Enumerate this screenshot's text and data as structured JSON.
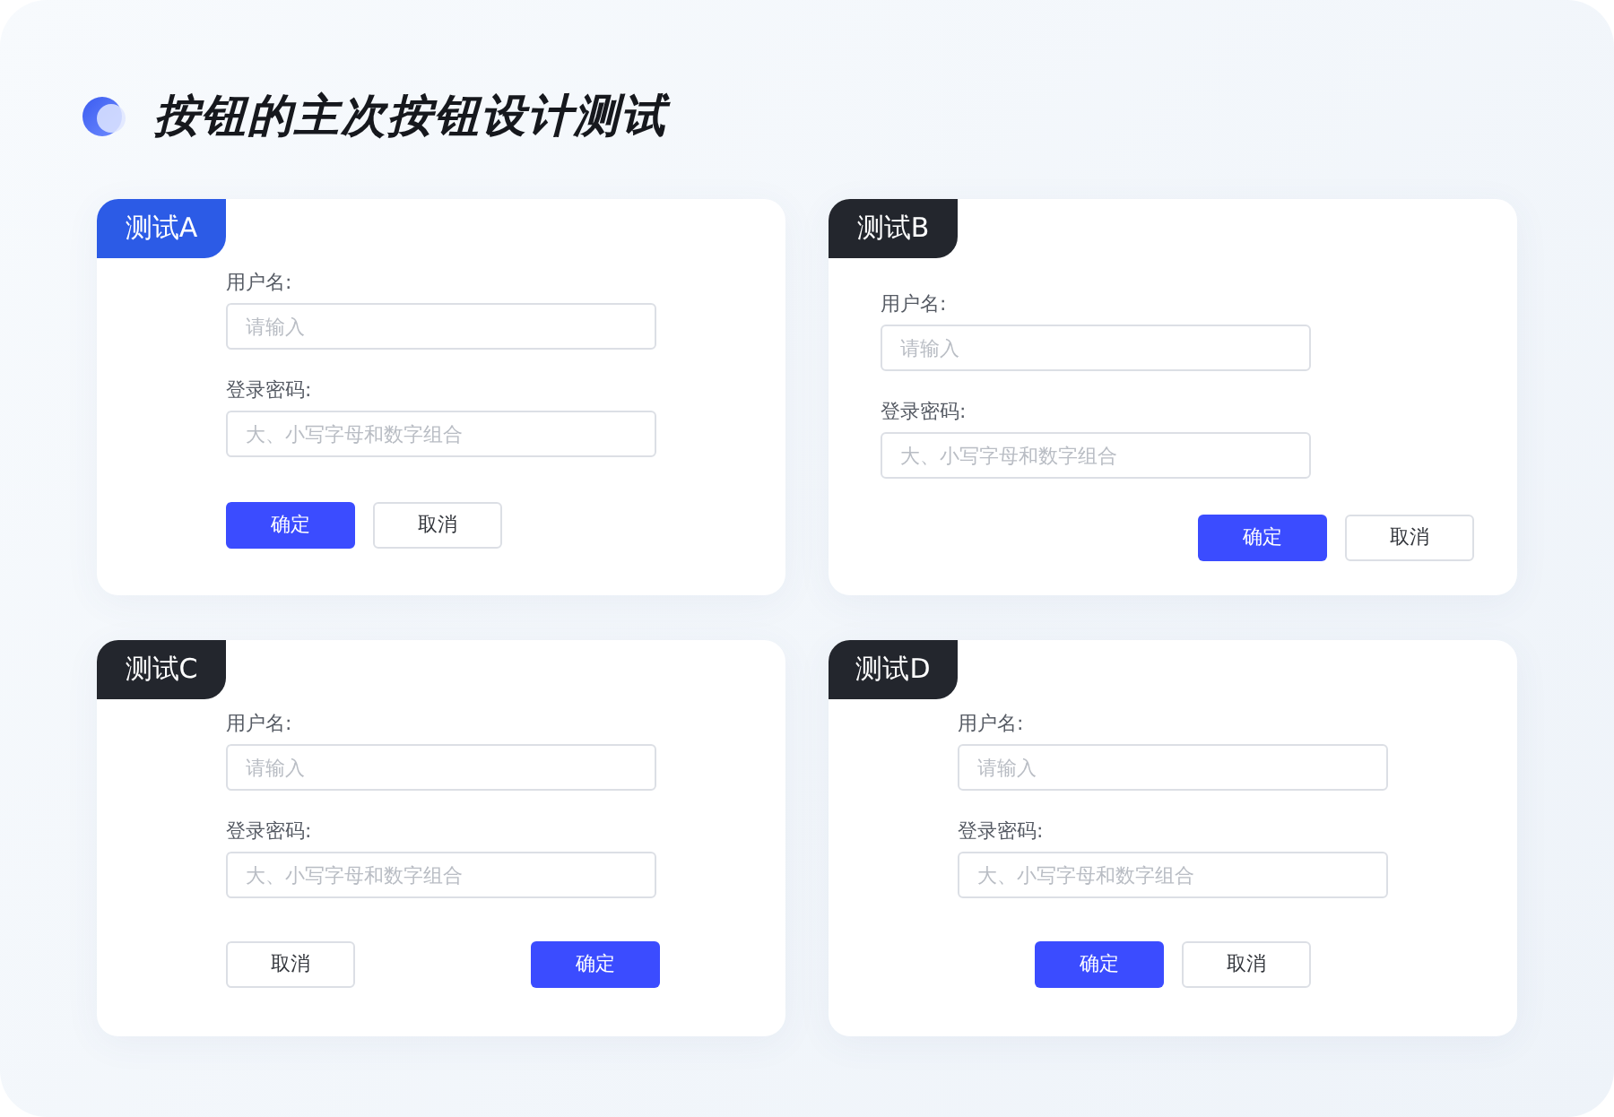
{
  "title": "按钮的主次按钮设计测试",
  "cards": [
    {
      "tab": {
        "label": "测试A",
        "color": "#2c5be6"
      },
      "kind": "start",
      "fields": [
        {
          "label": "用户名:",
          "placeholder": "请输入"
        },
        {
          "label": "登录密码:",
          "placeholder": "大、小写字母和数字组合"
        }
      ],
      "buttons": [
        {
          "label": "确定",
          "kind": "primary"
        },
        {
          "label": "取消",
          "kind": "secondary"
        }
      ]
    },
    {
      "tab": {
        "label": "测试B",
        "color": "#23262d"
      },
      "kind": "end",
      "fields": [
        {
          "label": "用户名:",
          "placeholder": "请输入"
        },
        {
          "label": "登录密码:",
          "placeholder": "大、小写字母和数字组合"
        }
      ],
      "buttons": [
        {
          "label": "确定",
          "kind": "primary"
        },
        {
          "label": "取消",
          "kind": "secondary"
        }
      ]
    },
    {
      "tab": {
        "label": "测试C",
        "color": "#23262d"
      },
      "kind": "between",
      "fields": [
        {
          "label": "用户名:",
          "placeholder": "请输入"
        },
        {
          "label": "登录密码:",
          "placeholder": "大、小写字母和数字组合"
        }
      ],
      "buttons": [
        {
          "label": "取消",
          "kind": "secondary"
        },
        {
          "label": "确定",
          "kind": "primary"
        }
      ]
    },
    {
      "tab": {
        "label": "测试D",
        "color": "#23262d"
      },
      "kind": "center",
      "fields": [
        {
          "label": "用户名:",
          "placeholder": "请输入"
        },
        {
          "label": "登录密码:",
          "placeholder": "大、小写字母和数字组合"
        }
      ],
      "buttons": [
        {
          "label": "确定",
          "kind": "primary"
        },
        {
          "label": "取消",
          "kind": "secondary"
        }
      ]
    }
  ]
}
